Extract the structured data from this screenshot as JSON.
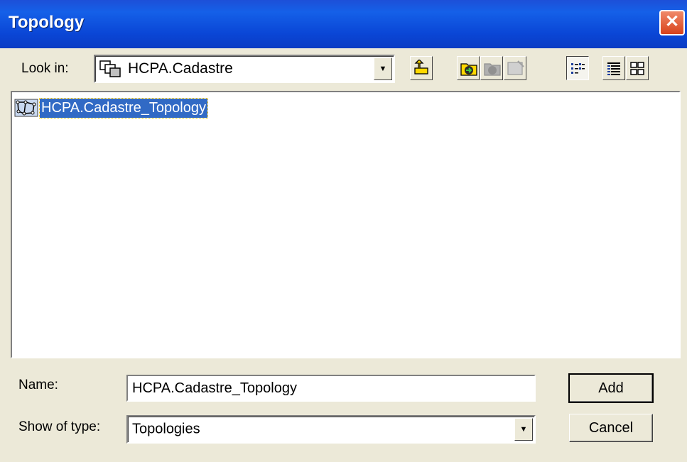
{
  "window": {
    "title": "Topology"
  },
  "lookin": {
    "label": "Look in:",
    "value": "HCPA.Cadastre"
  },
  "toolbar": {
    "up_icon": "up-one-level-icon",
    "connect_icon": "connect-to-folder-icon",
    "disconnect_icon": "disconnect-folder-icon",
    "properties_icon": "properties-icon",
    "list_icon": "list-view-icon",
    "details_icon": "details-view-icon",
    "thumbnails_icon": "thumbnails-view-icon"
  },
  "filelist": {
    "items": [
      {
        "label": "HCPA.Cadastre_Topology",
        "icon": "topology-icon",
        "selected": true
      }
    ]
  },
  "name": {
    "label": "Name:",
    "value": "HCPA.Cadastre_Topology"
  },
  "type": {
    "label": "Show of type:",
    "value": "Topologies"
  },
  "buttons": {
    "add": "Add",
    "cancel": "Cancel"
  },
  "colors": {
    "titlebar": "#0a46d6",
    "selection": "#316ac5",
    "close": "#d8421c"
  }
}
